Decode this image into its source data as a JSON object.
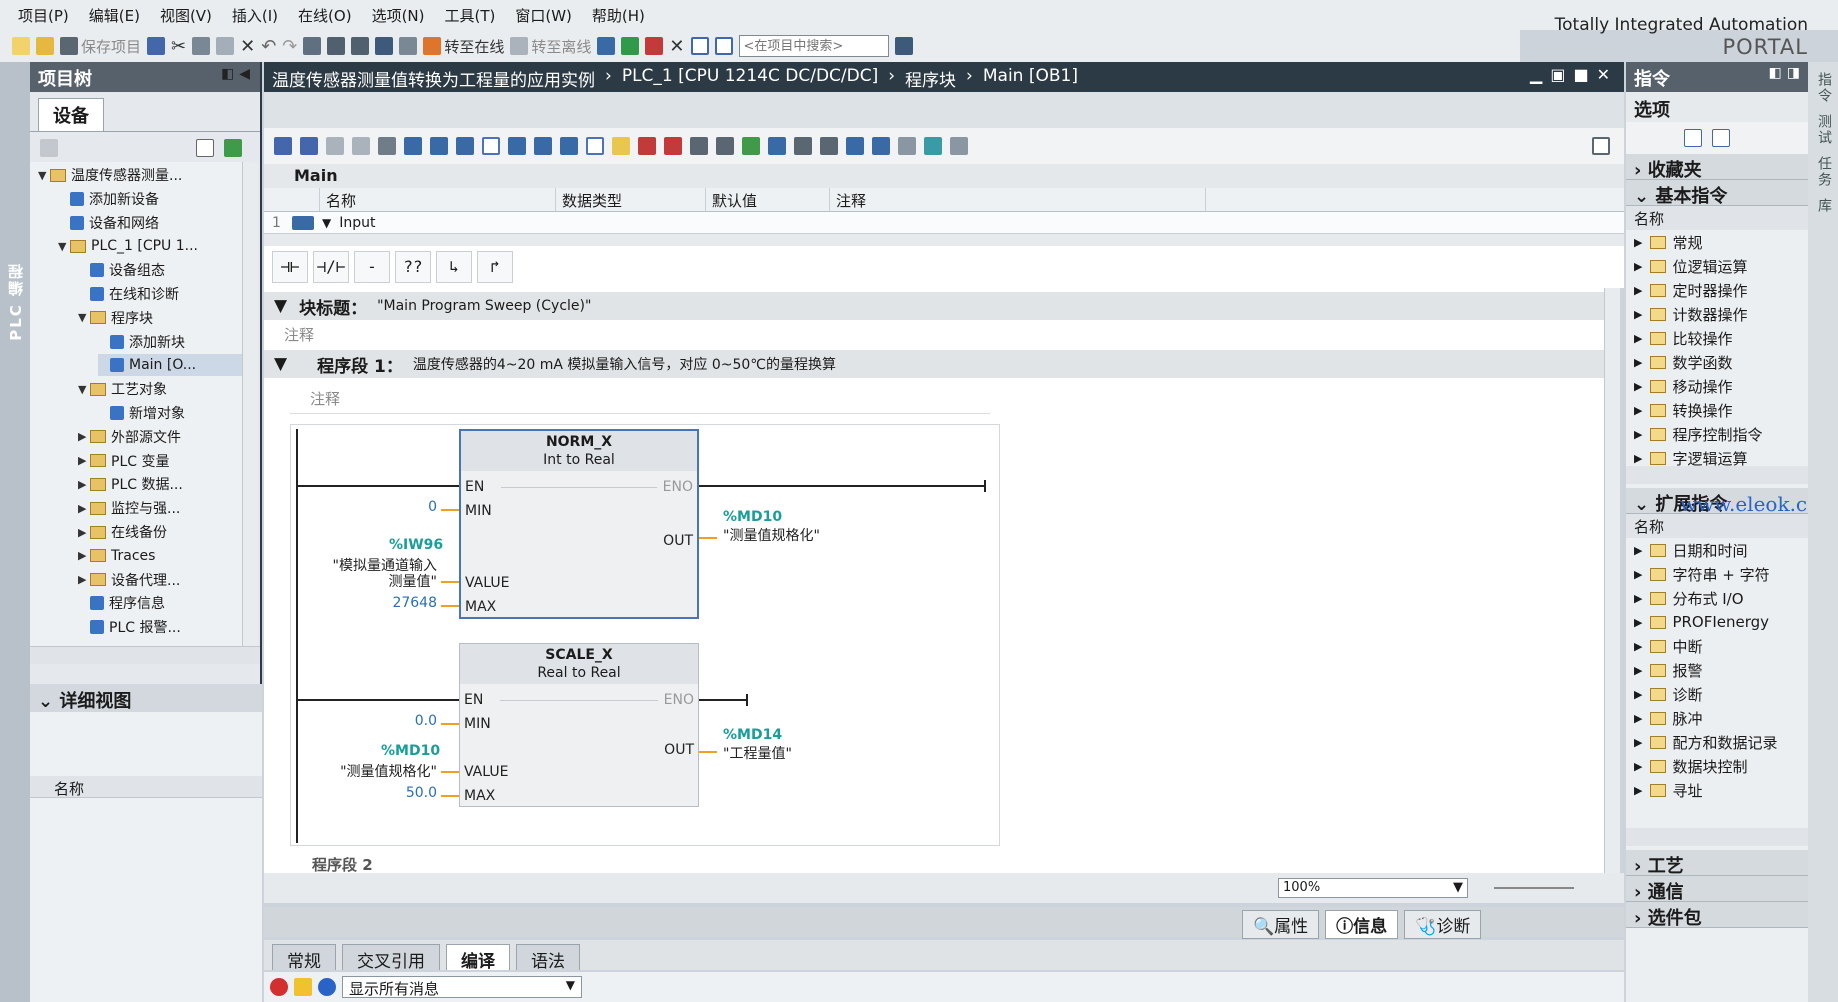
{
  "menu": [
    "项目(P)",
    "编辑(E)",
    "视图(V)",
    "插入(I)",
    "在线(O)",
    "选项(N)",
    "工具(T)",
    "窗口(W)",
    "帮助(H)"
  ],
  "brand": {
    "line1": "Totally Integrated Automation",
    "line2": "PORTAL"
  },
  "toolbar": {
    "save_project": "保存项目",
    "go_online": "转至在线",
    "go_offline": "转至离线",
    "search_placeholder": "<在项目中搜索>"
  },
  "left_strip_label": "PLC 编程",
  "project_tree": {
    "title": "项目树",
    "tab": "设备",
    "items": [
      {
        "label": "温度传感器测量...",
        "indent": 0,
        "expand": "open",
        "kind": "folder"
      },
      {
        "label": "添加新设备",
        "indent": 1,
        "expand": "",
        "kind": "leaf"
      },
      {
        "label": "设备和网络",
        "indent": 1,
        "expand": "",
        "kind": "leaf"
      },
      {
        "label": "PLC_1 [CPU 1...",
        "indent": 1,
        "expand": "open",
        "kind": "folder"
      },
      {
        "label": "设备组态",
        "indent": 2,
        "expand": "",
        "kind": "leaf"
      },
      {
        "label": "在线和诊断",
        "indent": 2,
        "expand": "",
        "kind": "leaf"
      },
      {
        "label": "程序块",
        "indent": 2,
        "expand": "open",
        "kind": "folder"
      },
      {
        "label": "添加新块",
        "indent": 3,
        "expand": "",
        "kind": "leaf"
      },
      {
        "label": "Main [O...",
        "indent": 3,
        "expand": "",
        "kind": "leaf"
      },
      {
        "label": "工艺对象",
        "indent": 2,
        "expand": "open",
        "kind": "folder"
      },
      {
        "label": "新增对象",
        "indent": 3,
        "expand": "",
        "kind": "leaf"
      },
      {
        "label": "外部源文件",
        "indent": 2,
        "expand": "closed",
        "kind": "folder"
      },
      {
        "label": "PLC 变量",
        "indent": 2,
        "expand": "closed",
        "kind": "folder"
      },
      {
        "label": "PLC 数据...",
        "indent": 2,
        "expand": "closed",
        "kind": "folder"
      },
      {
        "label": "监控与强...",
        "indent": 2,
        "expand": "closed",
        "kind": "folder"
      },
      {
        "label": "在线备份",
        "indent": 2,
        "expand": "closed",
        "kind": "folder"
      },
      {
        "label": "Traces",
        "indent": 2,
        "expand": "closed",
        "kind": "folder"
      },
      {
        "label": "设备代理...",
        "indent": 2,
        "expand": "closed",
        "kind": "folder"
      },
      {
        "label": "程序信息",
        "indent": 2,
        "expand": "",
        "kind": "leaf"
      },
      {
        "label": "PLC 报警...",
        "indent": 2,
        "expand": "",
        "kind": "leaf"
      }
    ]
  },
  "detail_view": {
    "title": "详细视图",
    "col_name": "名称"
  },
  "editor": {
    "breadcrumb": [
      "温度传感器测量值转换为工程量的应用实例",
      "PLC_1 [CPU 1214C DC/DC/DC]",
      "程序块",
      "Main [OB1]"
    ],
    "block_name": "Main",
    "iface_cols": [
      "名称",
      "数据类型",
      "默认值",
      "注释"
    ],
    "iface_row": {
      "num": "1",
      "name": "Input"
    },
    "ladder_buttons": [
      "⊣⊢",
      "⊣/⊢",
      "-()-",
      "??",
      "↳",
      "↱"
    ],
    "block_title_label": "块标题：",
    "block_title": "\"Main Program Sweep (Cycle)\"",
    "comment": "注释",
    "network_label": "程序段 1：",
    "network_title": "温度传感器的4~20 mA 模拟量输入信号，对应 0~50℃的量程换算",
    "network_comment": "注释",
    "network2_label": "程序段 2",
    "norm": {
      "name": "NORM_X",
      "types": "Int  to  Real",
      "en": "EN",
      "eno": "ENO",
      "min": "MIN",
      "value": "VALUE",
      "max": "MAX",
      "out": "OUT",
      "min_val": "0",
      "value_tag": "%IW96",
      "value_name1": "\"模拟量通道输入",
      "value_name2": "测量值\"",
      "max_val": "27648",
      "out_tag": "%MD10",
      "out_name": "\"测量值规格化\""
    },
    "scale": {
      "name": "SCALE_X",
      "types": "Real  to  Real",
      "en": "EN",
      "eno": "ENO",
      "min": "MIN",
      "value": "VALUE",
      "max": "MAX",
      "out": "OUT",
      "min_val": "0.0",
      "value_tag": "%MD10",
      "value_name": "\"测量值规格化\"",
      "max_val": "50.0",
      "out_tag": "%MD14",
      "out_name": "\"工程量值\""
    },
    "zoom": "100%"
  },
  "bottom": {
    "right_tabs": [
      "属性",
      "信息",
      "诊断"
    ],
    "tabs": [
      "常规",
      "交叉引用",
      "编译",
      "语法"
    ],
    "filter": "显示所有消息"
  },
  "instructions": {
    "title": "指令",
    "options": "选项",
    "favorites": "收藏夹",
    "basic": "基本指令",
    "col_name": "名称",
    "basic_items": [
      "常规",
      "位逻辑运算",
      "定时器操作",
      "计数器操作",
      "比较操作",
      "数学函数",
      "移动操作",
      "转换操作",
      "程序控制指令",
      "字逻辑运算"
    ],
    "extended": "扩展指令",
    "extended_items": [
      "日期和时间",
      "字符串 + 字符",
      "分布式 I/O",
      "PROFIenergy",
      "中断",
      "报警",
      "诊断",
      "脉冲",
      "配方和数据记录",
      "数据块控制",
      "寻址"
    ],
    "tech": "工艺",
    "comm": "通信",
    "optional": "选件包"
  },
  "right_strip": [
    "指令",
    "测试",
    "任务",
    "库"
  ],
  "watermark": "www.eleok.com"
}
